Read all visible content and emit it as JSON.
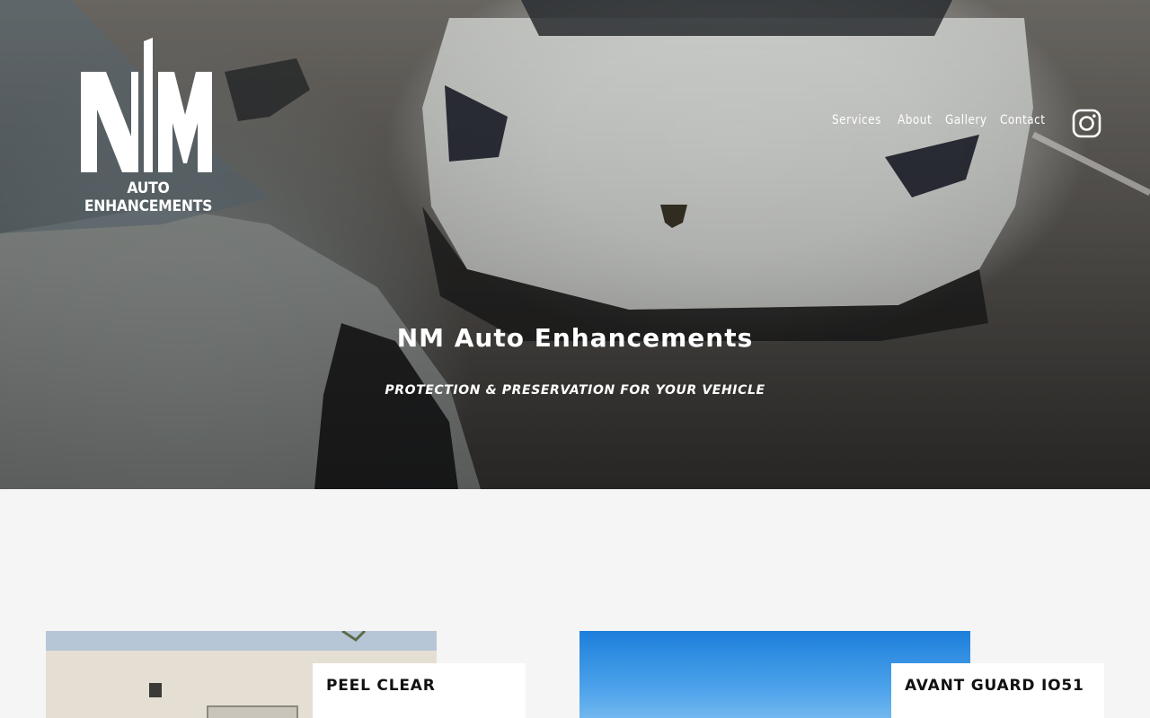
{
  "brand": {
    "logo_text": "AUTO ENHANCEMENTS",
    "logo_letters": "NM"
  },
  "nav": {
    "items": [
      {
        "label": "Services"
      },
      {
        "label": "About"
      },
      {
        "label": "Gallery"
      },
      {
        "label": "Contact"
      }
    ],
    "social_icon": "instagram-icon"
  },
  "hero": {
    "title": "NM Auto Enhancements",
    "subtitle": "PROTECTION & PRESERVATION FOR YOUR VEHICLE"
  },
  "cards": [
    {
      "label": "PEEL CLEAR"
    },
    {
      "label": "AVANT GUARD IO51"
    }
  ],
  "colors": {
    "text_on_hero": "#ffffff",
    "page_background": "#f5f5f5",
    "card_label_background": "#ffffff"
  }
}
